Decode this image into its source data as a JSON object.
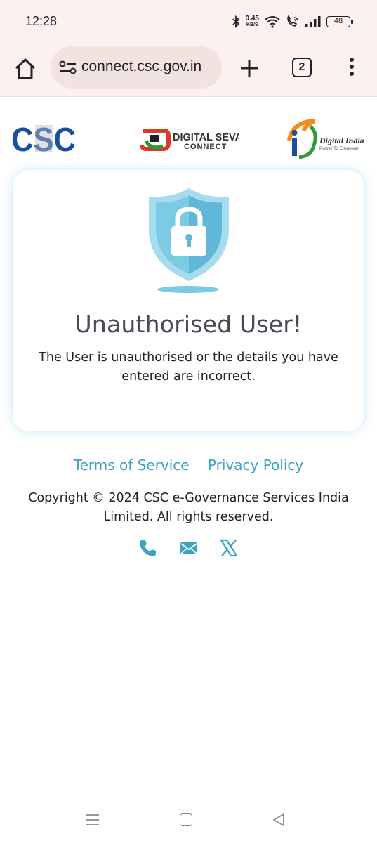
{
  "status_bar": {
    "time": "12:28",
    "net_speed_value": "0.45",
    "net_speed_unit": "KB/S",
    "battery": "48"
  },
  "browser": {
    "url": "connect.csc.gov.in",
    "tab_count": "2"
  },
  "logos": {
    "csc": "CSC",
    "digital_seva_line1": "DIGITAL SEVA",
    "digital_seva_line2": "CONNECT",
    "digital_india_line1": "Digital India",
    "digital_india_line2": "Power To Empower"
  },
  "card": {
    "title": "Unauthorised User!",
    "message": "The User is unauthorised or the details you have entered are incorrect."
  },
  "footer": {
    "terms": "Terms of Service",
    "privacy": "Privacy Policy",
    "copyright": "Copyright © 2024 CSC e-Governance Services India Limited. All rights reserved."
  },
  "colors": {
    "accent": "#3ea3c1",
    "csc_blue": "#1a4fa0",
    "toolbar_bg": "#fdf1ef",
    "shield_light": "#a6dcee",
    "shield_dark": "#5fb8d8"
  },
  "icons": {
    "social": [
      "phone-icon",
      "mail-icon",
      "x-icon"
    ]
  }
}
